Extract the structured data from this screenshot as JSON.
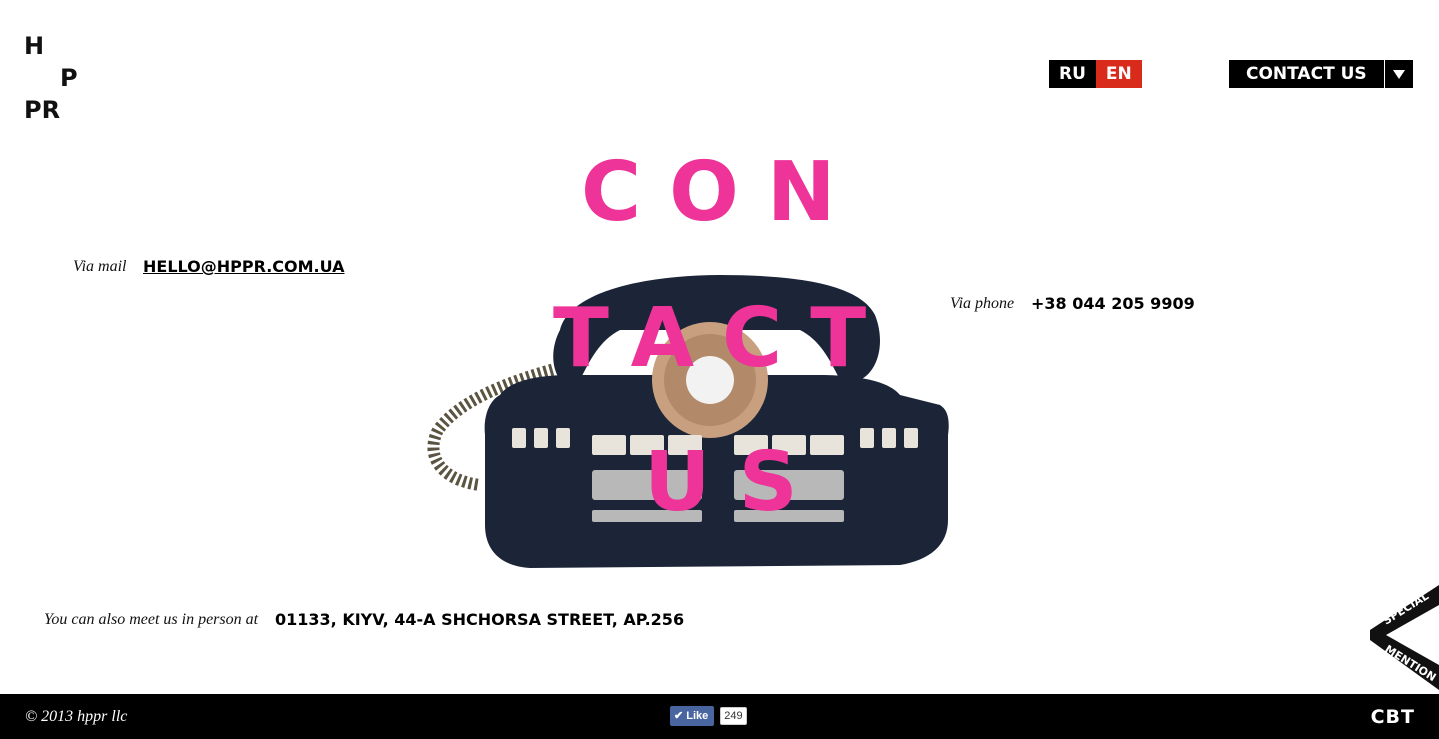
{
  "logo": {
    "line1": "H",
    "line2": "P",
    "line3": "PR"
  },
  "header": {
    "lang_ru": "RU",
    "lang_en": "EN",
    "contact_button": "CONTACT US"
  },
  "headline": {
    "line1": "CON",
    "line2": "TACT",
    "line3": "US"
  },
  "contacts": {
    "mail_label": "Via mail",
    "mail_value": "HELLO@HPPR.COM.UA",
    "phone_label": "Via phone",
    "phone_value": "+38 044 205 9909",
    "address_label": "You can also meet us in person at",
    "address_value": "01133, KIYV, 44-A SHCHORSA STREET, AP.256"
  },
  "ribbon": {
    "line1": "SPECIAL",
    "line2": "MENTION"
  },
  "footer": {
    "copyright": "© 2013 hppr llc",
    "like_label": "Like",
    "like_count": "249",
    "brand": "CBT"
  },
  "colors": {
    "accent_pink": "#ee3399",
    "lang_active": "#d92b1c",
    "phone_body": "#1c2538"
  }
}
